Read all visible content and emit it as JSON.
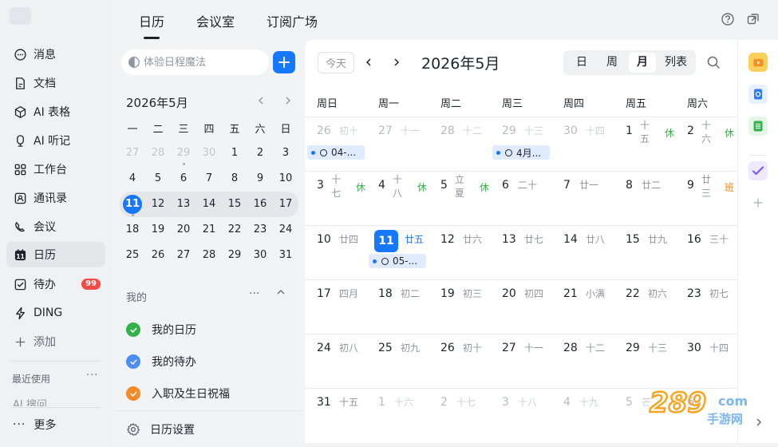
{
  "nav": {
    "items": [
      {
        "label": "消息",
        "icon": "message-icon"
      },
      {
        "label": "文档",
        "icon": "document-icon"
      },
      {
        "label": "AI 表格",
        "icon": "ai-table-icon"
      },
      {
        "label": "AI 听记",
        "icon": "ai-notes-icon"
      },
      {
        "label": "工作台",
        "icon": "workbench-icon"
      },
      {
        "label": "通讯录",
        "icon": "contacts-icon"
      },
      {
        "label": "会议",
        "icon": "meeting-icon"
      },
      {
        "label": "日历",
        "icon": "calendar-icon",
        "active": true
      },
      {
        "label": "待办",
        "icon": "todo-icon",
        "badge": "99"
      },
      {
        "label": "DING",
        "icon": "ding-icon"
      },
      {
        "label": "添加",
        "icon": "add-icon"
      }
    ],
    "recent_label": "最近使用",
    "recent_more": "···",
    "recent_partial_item": "AI 搜问",
    "more_label": "更多"
  },
  "tabs": [
    "日历",
    "会议室",
    "订阅广场"
  ],
  "side": {
    "search_placeholder": "体验日程魔法",
    "mini_title": "2026年5月",
    "weekday_heads": [
      "一",
      "二",
      "三",
      "四",
      "五",
      "六",
      "日"
    ],
    "weeks": [
      [
        "27",
        "28",
        "29",
        "30",
        "1",
        "2",
        "3"
      ],
      [
        "4",
        "5",
        "6",
        "7",
        "8",
        "9",
        "10"
      ],
      [
        "11",
        "12",
        "13",
        "14",
        "15",
        "16",
        "17"
      ],
      [
        "18",
        "19",
        "20",
        "21",
        "22",
        "23",
        "24"
      ],
      [
        "25",
        "26",
        "27",
        "28",
        "29",
        "30",
        "31"
      ]
    ],
    "my_label": "我的",
    "my_more": "···",
    "calendars": [
      {
        "label": "我的日历",
        "color": "#34b24a"
      },
      {
        "label": "我的待办",
        "color": "#4c8df6"
      },
      {
        "label": "入职及生日祝福",
        "color": "#f28c28"
      }
    ],
    "settings_label": "日历设置"
  },
  "main": {
    "today_label": "今天",
    "month_title": "2026年5月",
    "views": [
      "日",
      "周",
      "月",
      "列表"
    ],
    "active_view": "月",
    "weekday_heads": [
      "周日",
      "周一",
      "周二",
      "周三",
      "周四",
      "周五",
      "周六"
    ],
    "weeks": [
      [
        {
          "d": "26",
          "l": "初十",
          "dim": true
        },
        {
          "d": "27",
          "l": "十一",
          "dim": true
        },
        {
          "d": "28",
          "l": "十二",
          "dim": true
        },
        {
          "d": "29",
          "l": "十三",
          "dim": true
        },
        {
          "d": "30",
          "l": "十四",
          "dim": true
        },
        {
          "d": "1",
          "l": "十\n五",
          "tag": "休"
        },
        {
          "d": "2",
          "l": "十\n六",
          "tag": "休"
        }
      ],
      [
        {
          "d": "3",
          "l": "十\n七",
          "tag": "休"
        },
        {
          "d": "4",
          "l": "十\n八",
          "tag": "休"
        },
        {
          "d": "5",
          "l": "立\n夏",
          "tag": "休"
        },
        {
          "d": "6",
          "l": "二十"
        },
        {
          "d": "7",
          "l": "廿一"
        },
        {
          "d": "8",
          "l": "廿二"
        },
        {
          "d": "9",
          "l": "廿\n三",
          "tag": "班"
        }
      ],
      [
        {
          "d": "10",
          "l": "廿四"
        },
        {
          "d": "11",
          "l": "廿五",
          "today": true
        },
        {
          "d": "12",
          "l": "廿六"
        },
        {
          "d": "13",
          "l": "廿七"
        },
        {
          "d": "14",
          "l": "廿八"
        },
        {
          "d": "15",
          "l": "廿九"
        },
        {
          "d": "16",
          "l": "三十"
        }
      ],
      [
        {
          "d": "17",
          "l": "四月"
        },
        {
          "d": "18",
          "l": "初二"
        },
        {
          "d": "19",
          "l": "初三"
        },
        {
          "d": "20",
          "l": "初四"
        },
        {
          "d": "21",
          "l": "小满"
        },
        {
          "d": "22",
          "l": "初六"
        },
        {
          "d": "23",
          "l": "初七"
        }
      ],
      [
        {
          "d": "24",
          "l": "初八"
        },
        {
          "d": "25",
          "l": "初九"
        },
        {
          "d": "26",
          "l": "初十"
        },
        {
          "d": "27",
          "l": "十一"
        },
        {
          "d": "28",
          "l": "十二"
        },
        {
          "d": "29",
          "l": "十三"
        },
        {
          "d": "30",
          "l": "十四"
        }
      ],
      [
        {
          "d": "31",
          "l": "十五"
        },
        {
          "d": "1",
          "l": "十六",
          "dim": true
        },
        {
          "d": "2",
          "l": "十七",
          "dim": true
        },
        {
          "d": "3",
          "l": "十八",
          "dim": true
        },
        {
          "d": "4",
          "l": "十九",
          "dim": true
        },
        {
          "d": "5",
          "l": "芒",
          "dim": true
        },
        {
          "d": "6",
          "l": "",
          "dim": true
        }
      ]
    ],
    "events": [
      {
        "week": 0,
        "col": 0,
        "text": "04-..."
      },
      {
        "week": 0,
        "col": 3,
        "text": "4月..."
      },
      {
        "week": 2,
        "col": 1,
        "text": "05-..."
      }
    ]
  },
  "rail": {
    "apps": [
      "video-app-icon",
      "doc-app-icon",
      "sheet-app-icon",
      "task-app-icon"
    ]
  },
  "watermark": {
    "text": "289",
    "sub": "手游网",
    "suffix": "com"
  }
}
